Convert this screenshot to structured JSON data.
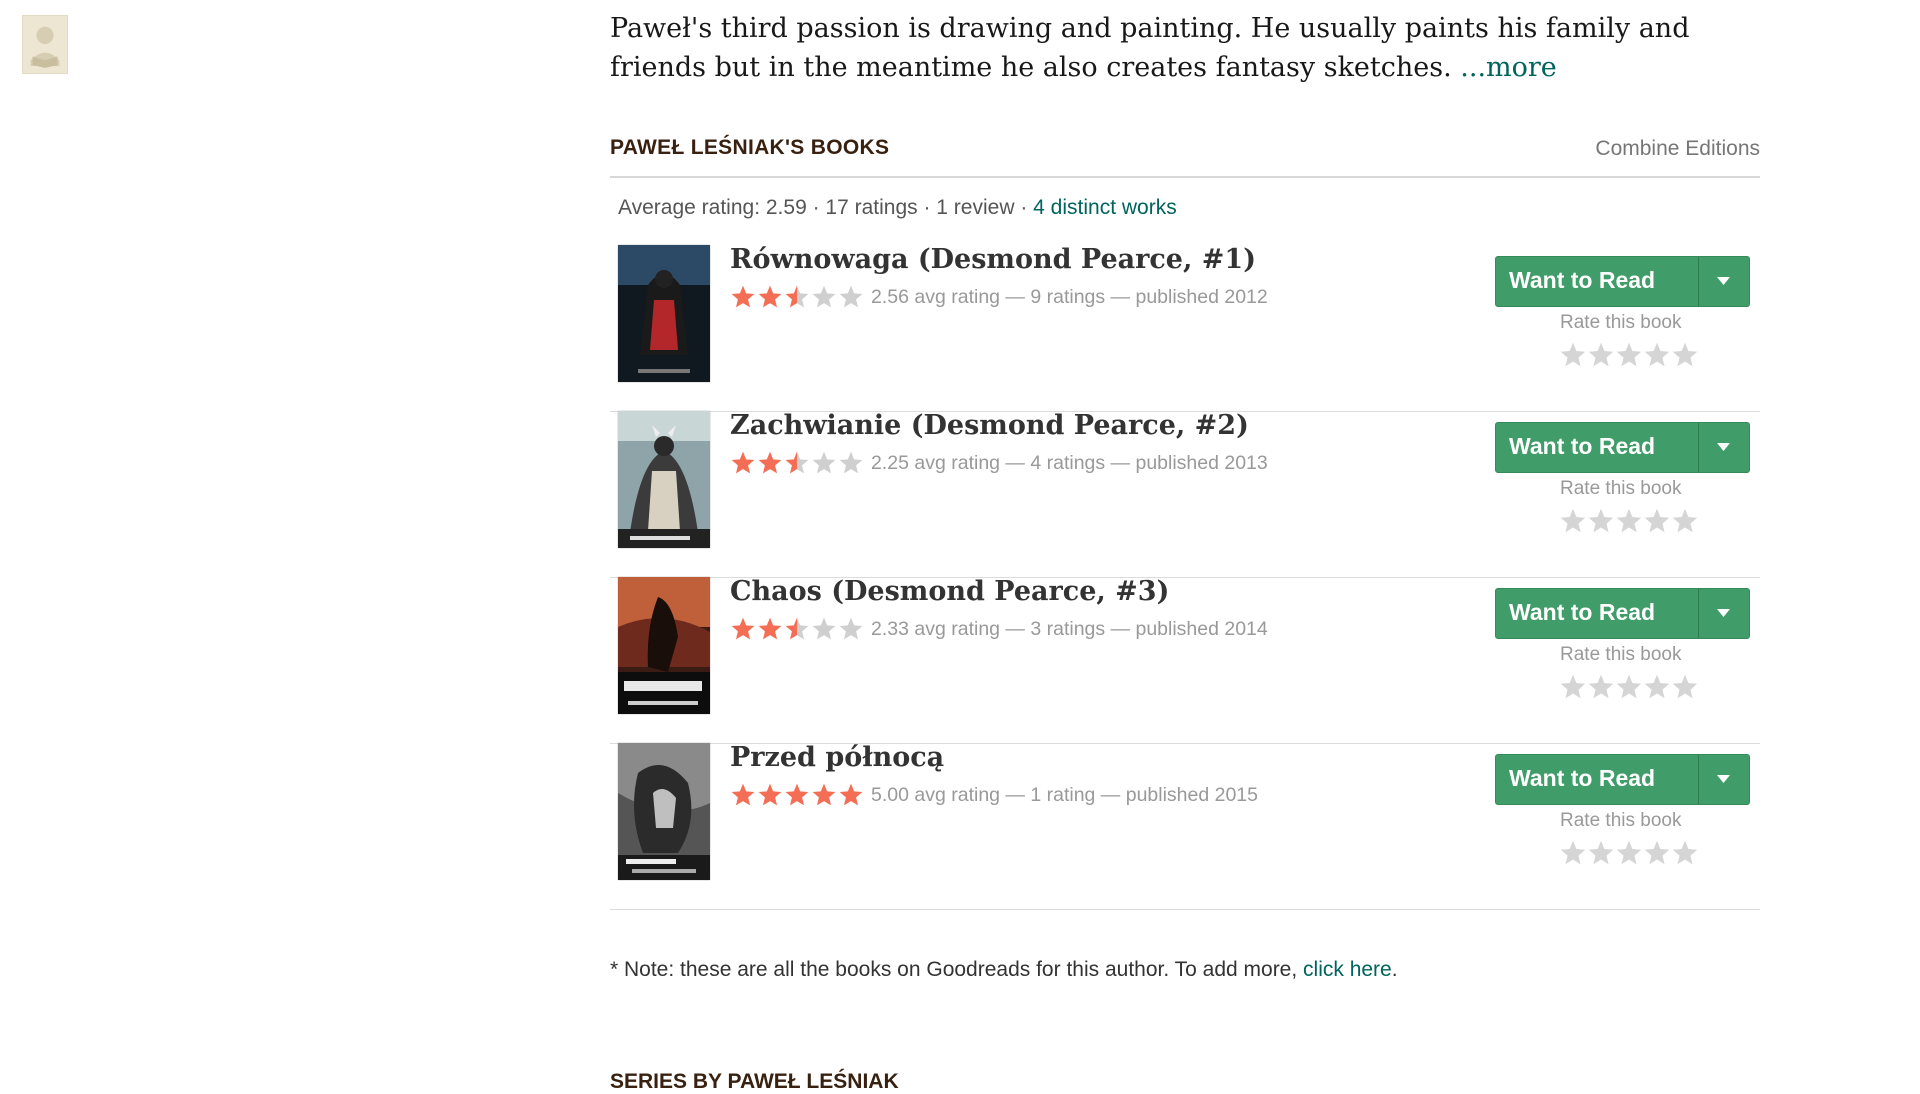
{
  "bio": {
    "text": "Paweł's third passion is drawing and painting. He usually paints his family and friends but in the meantime he also creates fantasy sketches. ",
    "more_link": "...more"
  },
  "books_section": {
    "title": "Paweł Leśniak's Books",
    "combine_editions": "Combine Editions",
    "average_prefix": "Average rating: 2.59 · 17 ratings · 1 review · ",
    "distinct_works": "4 distinct works"
  },
  "books": [
    {
      "title": "Równowaga (Desmond Pearce, #1)",
      "rating": 2.56,
      "minirating": "2.56 avg rating — 9 ratings — published 2012",
      "want_to_read": "Want to Read",
      "rate_label": "Rate this book"
    },
    {
      "title": "Zachwianie (Desmond Pearce, #2)",
      "rating": 2.25,
      "minirating": "2.25 avg rating — 4 ratings — published 2013",
      "want_to_read": "Want to Read",
      "rate_label": "Rate this book"
    },
    {
      "title": "Chaos (Desmond Pearce, #3)",
      "rating": 2.33,
      "minirating": "2.33 avg rating — 3 ratings — published 2014",
      "want_to_read": "Want to Read",
      "rate_label": "Rate this book"
    },
    {
      "title": "Przed północą",
      "rating": 5.0,
      "minirating": "5.00 avg rating — 1 rating — published 2015",
      "want_to_read": "Want to Read",
      "rate_label": "Rate this book"
    }
  ],
  "note": {
    "text": "* Note: these are all the books on Goodreads for this author. To add more, ",
    "link": "click here",
    "suffix": "."
  },
  "series_section": {
    "title": "Series by Paweł Leśniak"
  },
  "colors": {
    "star_filled": "#f36e55",
    "star_empty": "#cfcfcf",
    "button_green": "#409d69",
    "link_teal": "#00635d"
  }
}
